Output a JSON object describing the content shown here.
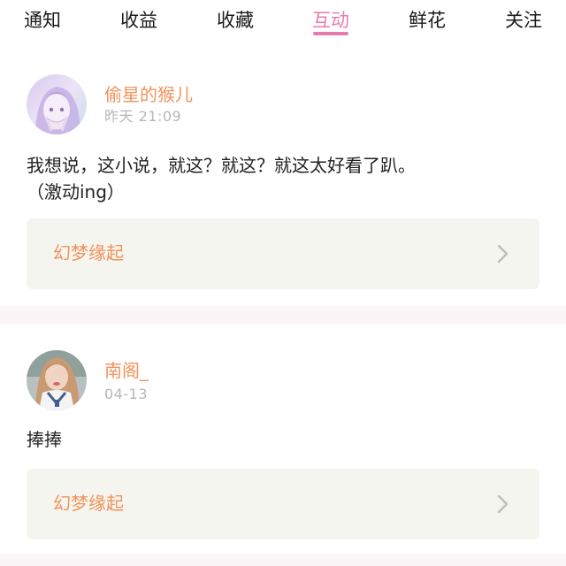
{
  "tabs": [
    {
      "label": "通知",
      "active": false
    },
    {
      "label": "收益",
      "active": false
    },
    {
      "label": "收藏",
      "active": false
    },
    {
      "label": "互动",
      "active": true
    },
    {
      "label": "鲜花",
      "active": false
    },
    {
      "label": "关注",
      "active": false
    }
  ],
  "colors": {
    "accent": "#e97ab0",
    "username": "#f0935c",
    "book_card_bg": "#f5f5ef",
    "timestamp": "#b7b7b7"
  },
  "posts": [
    {
      "username": "偷星的猴儿",
      "time": "昨天 21:09",
      "content_lines": [
        "我想说，这小说，就这？就这？就这太好看了趴。",
        "（激动ing）"
      ],
      "book_title": "幻梦缘起",
      "avatar_icon": "avatar-anime-girl-icon"
    },
    {
      "username": "南阁_",
      "time": "04-13",
      "content_lines": [
        "捧捧"
      ],
      "book_title": "幻梦缘起",
      "avatar_icon": "avatar-photo-girl-icon"
    }
  ]
}
